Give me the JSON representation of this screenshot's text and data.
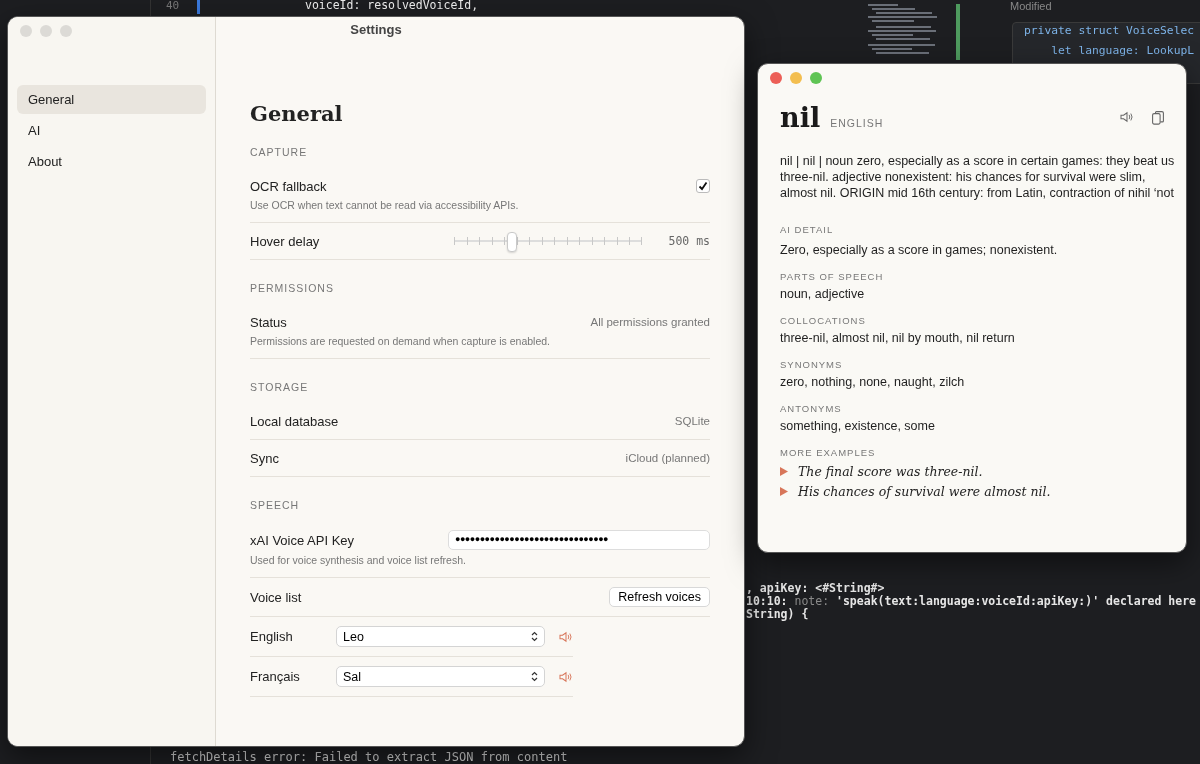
{
  "editor": {
    "top_line": {
      "number": "40",
      "code": "voiceId: resolvedVoiceId,"
    },
    "side_panel": {
      "status": "Modified",
      "lines": [
        "private struct VoiceSelec",
        "    let language: LookupL"
      ]
    },
    "console_lines": [
      [
        {
          "text": ", apiKey: <#String#>",
          "muted": false
        }
      ],
      [
        {
          "text": "10:10: ",
          "muted": false
        },
        {
          "text": "note: ",
          "muted": true
        },
        {
          "text": "'speak(text:language:voiceId:apiKey:)' declared here",
          "muted": false
        }
      ],
      [
        {
          "text": "String) {",
          "muted": false
        }
      ]
    ],
    "log_lines": [
      "fetchDetails error: Failed to extract JSON from content"
    ]
  },
  "settings": {
    "title": "Settings",
    "active": false,
    "sidebar": {
      "items": [
        {
          "label": "General",
          "selected": true
        },
        {
          "label": "AI",
          "selected": false
        },
        {
          "label": "About",
          "selected": false
        }
      ]
    },
    "heading": "General",
    "sections": [
      {
        "header": "CAPTURE",
        "rows": [
          {
            "kind": "checkbox",
            "label": "OCR fallback",
            "description": "Use OCR when text cannot be read via accessibility APIs.",
            "checked": true
          },
          {
            "kind": "slider",
            "label": "Hover delay",
            "level": 0.3,
            "reading": "500 ms"
          }
        ]
      },
      {
        "header": "PERMISSIONS",
        "rows": [
          {
            "kind": "value",
            "label": "Status",
            "value": "All permissions granted",
            "description": "Permissions are requested on demand when capture is enabled."
          }
        ]
      },
      {
        "header": "STORAGE",
        "rows": [
          {
            "kind": "value",
            "label": "Local database",
            "value": "SQLite"
          },
          {
            "kind": "value",
            "label": "Sync",
            "value": "iCloud (planned)"
          }
        ]
      },
      {
        "header": "SPEECH",
        "rows": [
          {
            "kind": "secret",
            "label": "xAI Voice API Key",
            "value": "●●●●●●●●●●●●●●●●●●●●●●●●●●●●●●●",
            "description": "Used for voice synthesis and voice list refresh."
          },
          {
            "kind": "button",
            "label": "Voice list",
            "button": "Refresh voices"
          },
          {
            "kind": "select",
            "label": "English",
            "value": "Leo"
          },
          {
            "kind": "select",
            "label": "Français",
            "value": "Sal"
          }
        ]
      }
    ]
  },
  "lookup": {
    "active": true,
    "word": "nil",
    "language": "ENGLISH",
    "definition": "nil | nil | noun zero, especially as a score in certain games: they beat us three-nil. adjective nonexistent: his chances for survival were slim, almost nil. ORIGIN mid 16th century: from Latin, contraction of nihil ‘not",
    "sections": [
      {
        "kind": "text",
        "header": "AI DETAIL",
        "text": "Zero, especially as a score in games; nonexistent."
      },
      {
        "kind": "list",
        "header": "PARTS OF SPEECH",
        "text": "noun, adjective"
      },
      {
        "kind": "list",
        "header": "COLLOCATIONS",
        "text": "three-nil, almost nil, nil by mouth, nil return"
      },
      {
        "kind": "list",
        "header": "SYNONYMS",
        "text": "zero, nothing, none, naught, zilch"
      },
      {
        "kind": "list",
        "header": "ANTONYMS",
        "text": "something, existence, some"
      },
      {
        "kind": "examples",
        "header": "MORE EXAMPLES",
        "items": [
          "The final score was three-nil.",
          "His chances of survival were almost nil."
        ]
      }
    ]
  }
}
